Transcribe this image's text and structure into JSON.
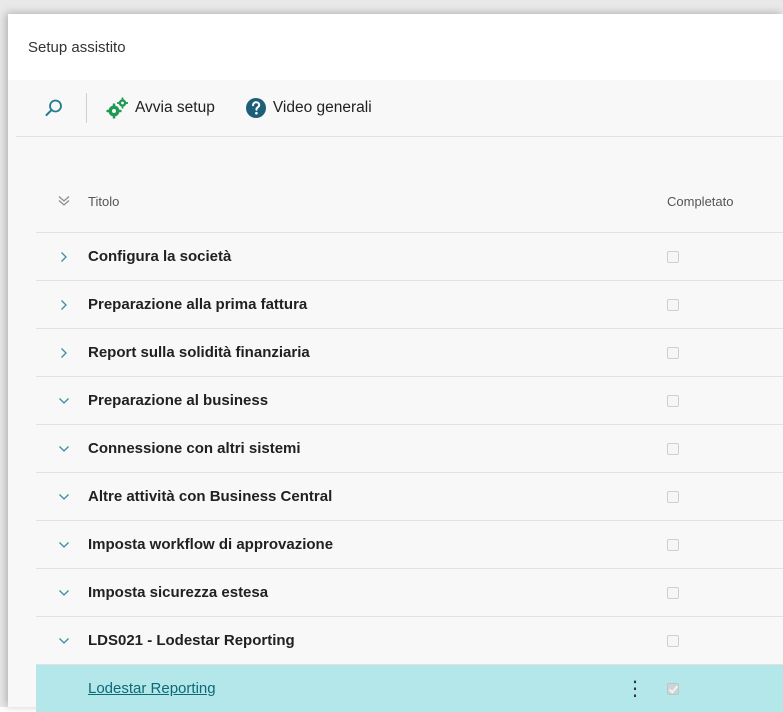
{
  "window": {
    "title": "Setup assistito"
  },
  "toolbar": {
    "search_icon": "search-icon",
    "start_setup_label": "Avvia setup",
    "videos_label": "Video generali"
  },
  "list": {
    "columns": {
      "title": "Titolo",
      "completed": "Completato"
    },
    "rows": [
      {
        "title": "Configura la società",
        "expanded": false,
        "completed": false
      },
      {
        "title": "Preparazione alla prima fattura",
        "expanded": false,
        "completed": false
      },
      {
        "title": "Report sulla solidità finanziaria",
        "expanded": false,
        "completed": false
      },
      {
        "title": "Preparazione al business",
        "expanded": true,
        "completed": false
      },
      {
        "title": "Connessione con altri sistemi",
        "expanded": true,
        "completed": false
      },
      {
        "title": "Altre attività con Business Central",
        "expanded": true,
        "completed": false
      },
      {
        "title": "Imposta workflow di approvazione",
        "expanded": true,
        "completed": false
      },
      {
        "title": "Imposta sicurezza estesa",
        "expanded": true,
        "completed": false
      },
      {
        "title": "LDS021 - Lodestar Reporting",
        "expanded": true,
        "completed": false
      }
    ],
    "selected_row": {
      "title": "Lodestar Reporting",
      "menu_glyph": "⋮",
      "completed": true
    }
  },
  "colors": {
    "accent": "#0b6a74",
    "selected_row": "#b4e7ea",
    "chevron": "#3a8fa0"
  }
}
